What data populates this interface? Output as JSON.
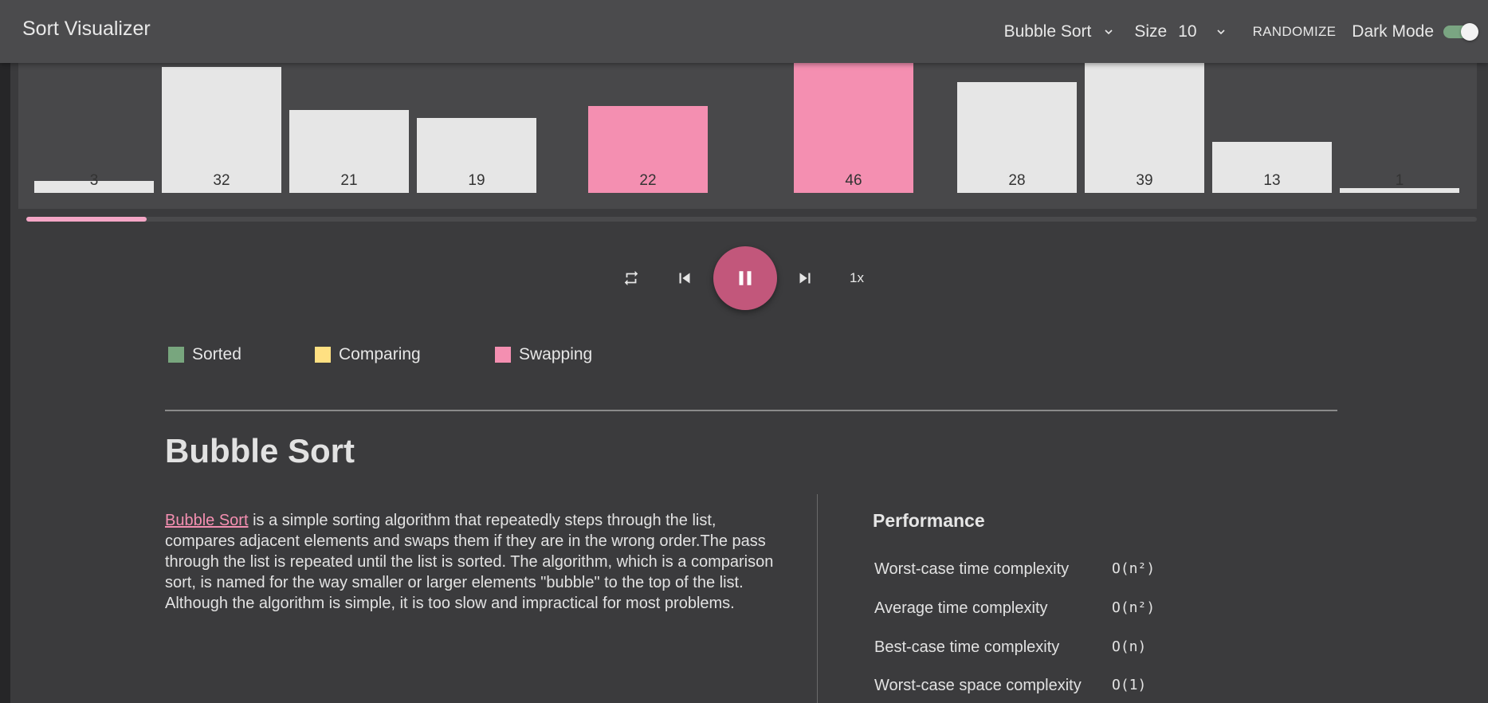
{
  "header": {
    "title": "Sort Visualizer",
    "algorithm": "Bubble Sort",
    "size_label": "Size",
    "size_value": "10",
    "randomize": "RANDOMIZE",
    "dark_mode_label": "Dark Mode",
    "dark_mode_on": true
  },
  "array": {
    "values": [
      "3",
      "32",
      "21",
      "19",
      "22",
      "46",
      "28",
      "39",
      "13",
      "1"
    ],
    "swapping_indices": [
      4,
      5
    ]
  },
  "progress": {
    "fraction": 0.083
  },
  "controls": {
    "speed": "1x",
    "state": "playing"
  },
  "legend": [
    {
      "label": "Sorted",
      "color": "#78a67e"
    },
    {
      "label": "Comparing",
      "color": "#ffe082"
    },
    {
      "label": "Swapping",
      "color": "#f48fb1"
    }
  ],
  "colors": {
    "accent": "#c2577b",
    "bar": "#e6e6e6",
    "swap": "#f48fb1"
  },
  "algorithm": {
    "title": "Bubble Sort",
    "link_text": "Bubble Sort",
    "description": " is a simple sorting algorithm that repeatedly steps through the list, compares adjacent elements and swaps them if they are in the wrong order.The pass through the list is repeated until the list is sorted. The algorithm, which is a comparison sort, is named for the way smaller or larger elements \"bubble\" to the top of the list. Although the algorithm is simple, it is too slow and impractical for most problems."
  },
  "performance": {
    "title": "Performance",
    "rows": [
      {
        "label": "Worst-case time complexity",
        "value": "O(n²)"
      },
      {
        "label": "Average time complexity",
        "value": "O(n²)"
      },
      {
        "label": "Best-case time complexity",
        "value": "O(n)"
      },
      {
        "label": "Worst-case space complexity",
        "value": "O(1)"
      }
    ]
  }
}
